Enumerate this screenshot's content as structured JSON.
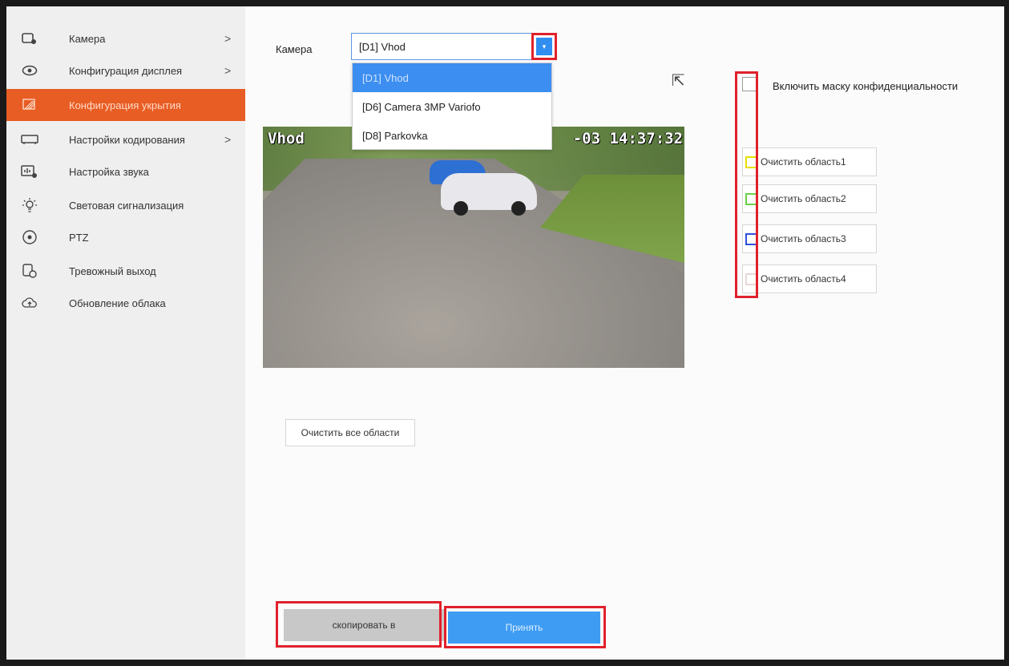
{
  "sidebar": {
    "items": [
      {
        "label": "Камера",
        "icon": "camera-icon",
        "chevron": ">"
      },
      {
        "label": "Конфигурация дисплея",
        "icon": "eye-icon",
        "chevron": ">"
      },
      {
        "label": "Конфигурация укрытия",
        "icon": "privacy-mask-icon",
        "chevron": ""
      },
      {
        "label": "Настройки кодирования",
        "icon": "encoding-icon",
        "chevron": ">"
      },
      {
        "label": "Настройка звука",
        "icon": "audio-icon",
        "chevron": ""
      },
      {
        "label": "Световая сигнализация",
        "icon": "light-alarm-icon",
        "chevron": ""
      },
      {
        "label": "PTZ",
        "icon": "ptz-icon",
        "chevron": ""
      },
      {
        "label": "Тревожный выход",
        "icon": "alarm-output-icon",
        "chevron": ""
      },
      {
        "label": "Обновление облака",
        "icon": "cloud-update-icon",
        "chevron": ""
      }
    ],
    "active_index": 2,
    "accent_color": "#e85d24"
  },
  "main": {
    "camera_label": "Камера",
    "camera_select_value": "[D1] Vhod",
    "dropdown_options": [
      "[D1] Vhod",
      "[D6] Camera 3MP Variofo",
      "[D8] Parkovka"
    ],
    "dropdown_selected_index": 0,
    "video": {
      "osd_name": "Vhod",
      "osd_time": "-03 14:37:32"
    },
    "mask_enable_label": "Включить маску конфиденциальности",
    "areas": [
      {
        "label": "Очистить область1",
        "color": "#e8e000"
      },
      {
        "label": "Очистить область2",
        "color": "#6ad04a"
      },
      {
        "label": "Очистить область3",
        "color": "#3050e0"
      },
      {
        "label": "Очистить область4",
        "color": "#e8d8d8"
      }
    ],
    "clear_all_label": "Очистить все области",
    "copy_label": "скопировать в",
    "apply_label": "Принять",
    "primary_color": "#3e9cf3",
    "highlight_color": "#e0212b"
  }
}
